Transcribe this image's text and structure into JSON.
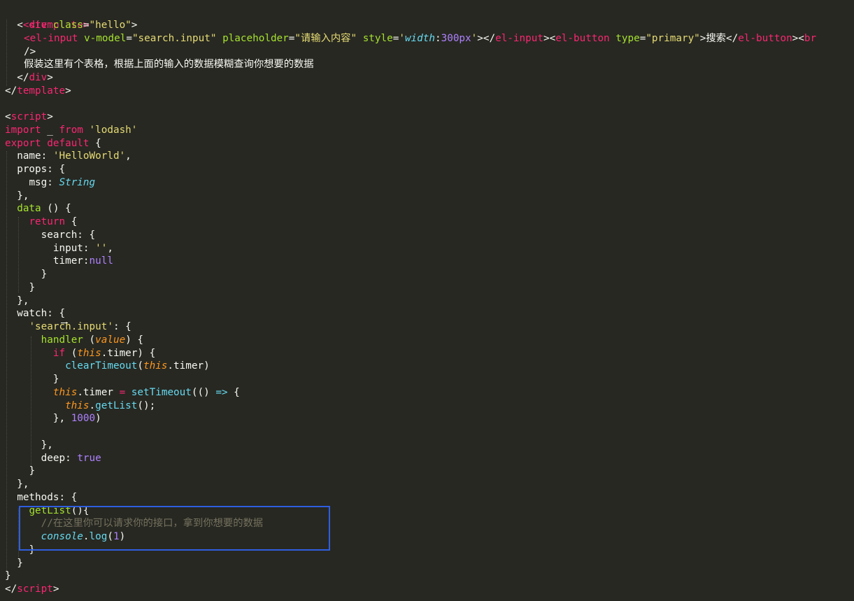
{
  "code": {
    "t1": "<template>",
    "t2a": "<div",
    "t2b": "class",
    "t2c": "=",
    "t2d": "\"hello\"",
    "t2e": ">",
    "t3a": "<el-input",
    "t3b": "v-model",
    "t3c": "=",
    "t3d": "\"search.input\"",
    "t3e": "placeholder",
    "t3f": "=",
    "t3g": "\"请输入内容\"",
    "t3h": "style",
    "t3i": "=",
    "t3j": "'",
    "t3k": "width",
    "t3l": ":",
    "t3m": "300px",
    "t3n": "'",
    "t3o": "></",
    "t3p": "el-input",
    "t3q": "><",
    "t3r": "el-button",
    "t3s": "type",
    "t3t": "=",
    "t3u": "\"primary\"",
    "t3v": ">搜索</",
    "t3w": "el-button",
    "t3x": "><",
    "t3y": "br",
    "t4": "/>",
    "t5": "假装这里有个表格，根据上面的输入的数据模糊查询你想要的数据",
    "t6a": "</",
    "t6b": "div",
    "t6c": ">",
    "t7a": "</",
    "t7b": "template",
    "t7c": ">",
    "t9a": "<",
    "t9b": "script",
    "t9c": ">",
    "t10a": "import",
    "t10b": " _ ",
    "t10c": "from",
    "t10d": "'lodash'",
    "t11a": "export",
    "t11b": "default",
    "t11c": "{",
    "t12a": "name: ",
    "t12b": "'HelloWorld'",
    "t12c": ",",
    "t13": "props: {",
    "t14a": "msg: ",
    "t14b": "String",
    "t15": "},",
    "t16a": "data",
    "t16b": " () {",
    "t17a": "return",
    "t17b": " {",
    "t18": "search: {",
    "t19a": "input: ",
    "t19b": "''",
    "t19c": ",",
    "t20a": "timer:",
    "t20b": "null",
    "t21": "}",
    "t22": "}",
    "t23": "},",
    "t24": "watch: {",
    "t25a": "'search.input'",
    "t25b": ": {",
    "t26a": "handler",
    "t26b": " (",
    "t26c": "value",
    "t26d": ") {",
    "t27a": "if",
    "t27b": " (",
    "t27c": "this",
    "t27d": ".timer) {",
    "t28a": "clearTimeout",
    "t28b": "(",
    "t28c": "this",
    "t28d": ".timer)",
    "t29": "}",
    "t30a": "this",
    "t30b": ".timer ",
    "t30c": "=",
    "t30d": " ",
    "t30e": "setTimeout",
    "t30f": "(() ",
    "t30g": "=>",
    "t30h": " {",
    "t31a": "this",
    "t31b": ".",
    "t31c": "getList",
    "t31d": "();",
    "t32a": "}, ",
    "t32b": "1000",
    "t32c": ")",
    "t34": "},",
    "t35a": "deep: ",
    "t35b": "true",
    "t36": "}",
    "t37": "},",
    "t38": "methods: {",
    "t39a": "getList",
    "t39b": "(){",
    "t40": "//在这里你可以请求你的接口，拿到你想要的数据",
    "t41a": "console",
    "t41b": ".",
    "t41c": "log",
    "t41d": "(",
    "t41e": "1",
    "t41f": ")",
    "t42": "}",
    "t43": "}",
    "t44": "}",
    "t45a": "</",
    "t45b": "script",
    "t45c": ">"
  },
  "colors": {
    "background": "#272822",
    "tag": "#f92672",
    "attribute": "#a6e22e",
    "string": "#e6db74",
    "builtin": "#66d9ef",
    "parameter": "#fd971f",
    "number": "#ae81ff",
    "comment": "#75715e",
    "highlight_box": "#2f5fe0"
  }
}
